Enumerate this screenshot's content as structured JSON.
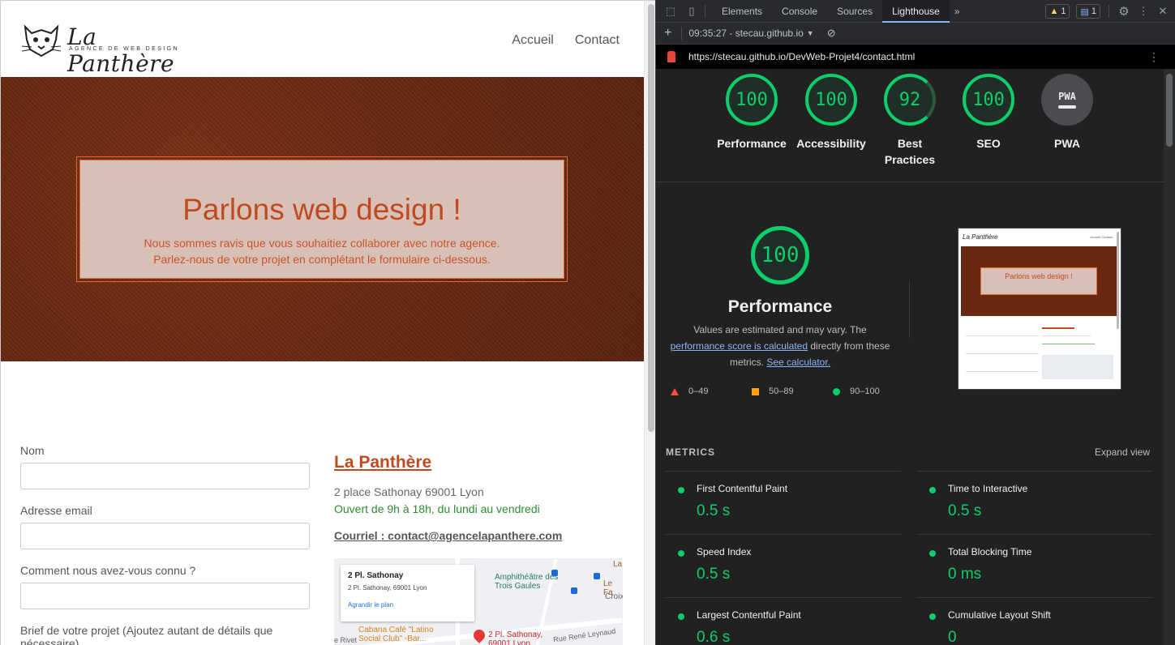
{
  "site": {
    "logo": {
      "name": "La Panthère",
      "tagline": "AGENCE DE WEB DESIGN"
    },
    "nav": [
      {
        "label": "Accueil"
      },
      {
        "label": "Contact"
      }
    ],
    "hero": {
      "title": "Parlons web design !",
      "line1": "Nous sommes ravis que vous souhaitiez collaborer avec notre agence.",
      "line2": "Parlez-nous de votre projet en complétant le formulaire ci-dessous."
    },
    "form": {
      "name_label": "Nom",
      "email_label": "Adresse email",
      "source_label": "Comment nous avez-vous connu ?",
      "brief_label": "Brief de votre projet (Ajoutez autant de détails que nécessaire)"
    },
    "contact": {
      "title": "La Panthère",
      "address": "2 place Sathonay 69001 Lyon",
      "hours": "Ouvert de 9h à 18h, du lundi au vendredi",
      "email": "Courriel : contact@agencelapanthere.com"
    },
    "map": {
      "card_title": "2 Pl. Sathonay",
      "card_address": "2 Pl. Sathonay, 69001 Lyon",
      "card_link": "Agrandir le plan",
      "label_amphi": "Amphithéâtre des Trois Gaules",
      "label_cabana": "Cabana Café \"Latino Social Club\" -Bar...",
      "label_pin": "2 Pl. Sathonay, 69001 Lyon",
      "label_street": "Rue René Leynaud",
      "label_rivet": "e Rivet",
      "label_lafe": "Le Fa",
      "label_croix": "Croix",
      "label_la": "La"
    }
  },
  "devtools": {
    "tabs": [
      {
        "label": "Elements"
      },
      {
        "label": "Console"
      },
      {
        "label": "Sources"
      },
      {
        "label": "Lighthouse"
      }
    ],
    "warnings_count": "1",
    "messages_count": "1",
    "report_selector": "09:35:27 - stecau.github.io",
    "url": "https://stecau.github.io/DevWeb-Projet4/contact.html",
    "colors": {
      "pass": "#0cce6b",
      "average": "#ffa400",
      "fail": "#ff4e42",
      "accent": "#8ab4f8"
    }
  },
  "lighthouse": {
    "categories": [
      {
        "score": "100",
        "label": "Performance"
      },
      {
        "score": "100",
        "label": "Accessibility"
      },
      {
        "score": "92",
        "label": "Best Practices"
      },
      {
        "score": "100",
        "label": "SEO"
      },
      {
        "score": "PWA",
        "label": "PWA"
      }
    ],
    "performance": {
      "score": "100",
      "title": "Performance",
      "desc_pre": "Values are estimated and may vary. The ",
      "desc_link": "performance score is calculated",
      "desc_mid": " directly from these metrics. ",
      "desc_link2": "See calculator."
    },
    "legend": [
      {
        "label": "0–49"
      },
      {
        "label": "50–89"
      },
      {
        "label": "90–100"
      }
    ],
    "thumbnail": {
      "logo": "La Panthère",
      "hero_title": "Parlons web design !",
      "nav": "Accueil   Contact"
    },
    "metrics_title": "METRICS",
    "expand_label": "Expand view",
    "metrics": [
      {
        "name": "First Contentful Paint",
        "value": "0.5 s"
      },
      {
        "name": "Time to Interactive",
        "value": "0.5 s"
      },
      {
        "name": "Speed Index",
        "value": "0.5 s"
      },
      {
        "name": "Total Blocking Time",
        "value": "0 ms"
      },
      {
        "name": "Largest Contentful Paint",
        "value": "0.6 s"
      },
      {
        "name": "Cumulative Layout Shift",
        "value": "0"
      }
    ]
  }
}
